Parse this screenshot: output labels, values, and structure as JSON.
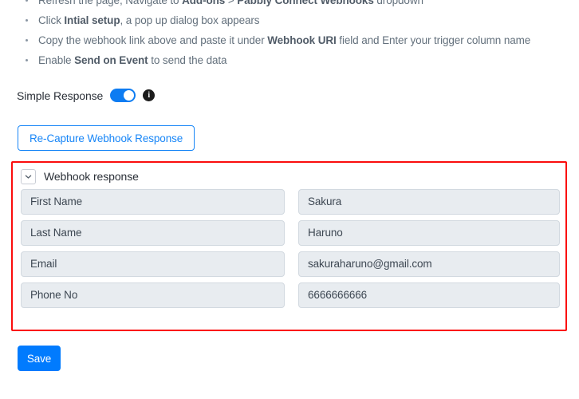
{
  "instructions": [
    {
      "parts": [
        {
          "text": "Refresh the page, Navigate to ",
          "bold": false
        },
        {
          "text": "Add-ons",
          "bold": true
        },
        {
          "text": " > ",
          "bold": false
        },
        {
          "text": "Pabbly Connect Webhooks",
          "bold": true
        },
        {
          "text": " dropdown",
          "bold": false
        }
      ]
    },
    {
      "parts": [
        {
          "text": "Click ",
          "bold": false
        },
        {
          "text": "Intial setup",
          "bold": true
        },
        {
          "text": ", a pop up dialog box appears",
          "bold": false
        }
      ]
    },
    {
      "parts": [
        {
          "text": "Copy the webhook link above and paste it under ",
          "bold": false
        },
        {
          "text": "Webhook URI",
          "bold": true
        },
        {
          "text": " field and Enter your trigger column name",
          "bold": false
        }
      ]
    },
    {
      "parts": [
        {
          "text": "Enable ",
          "bold": false
        },
        {
          "text": "Send on Event",
          "bold": true
        },
        {
          "text": " to send the data",
          "bold": false
        }
      ]
    }
  ],
  "simple_response": {
    "label": "Simple Response",
    "toggle_state": "on",
    "info_glyph": "i",
    "info_icon_name": "info-icon"
  },
  "recapture_button": {
    "label": "Re-Capture Webhook Response"
  },
  "webhook_response_panel": {
    "title": "Webhook response",
    "collapsed": false,
    "highlight_color": "#fb0d0d",
    "rows": [
      {
        "key": "First Name",
        "value": "Sakura"
      },
      {
        "key": "Last Name",
        "value": "Haruno"
      },
      {
        "key": "Email",
        "value": "sakuraharuno@gmail.com"
      },
      {
        "key": "Phone No",
        "value": "6666666666"
      }
    ]
  },
  "save_button": {
    "label": "Save"
  },
  "colors": {
    "accent_blue": "#017bfe",
    "link_blue": "#1886f7",
    "toggle_on": "#0d7cf2",
    "highlight_red": "#fb0d0d",
    "field_bg": "#e8ecf0",
    "text_muted": "#64717d"
  }
}
